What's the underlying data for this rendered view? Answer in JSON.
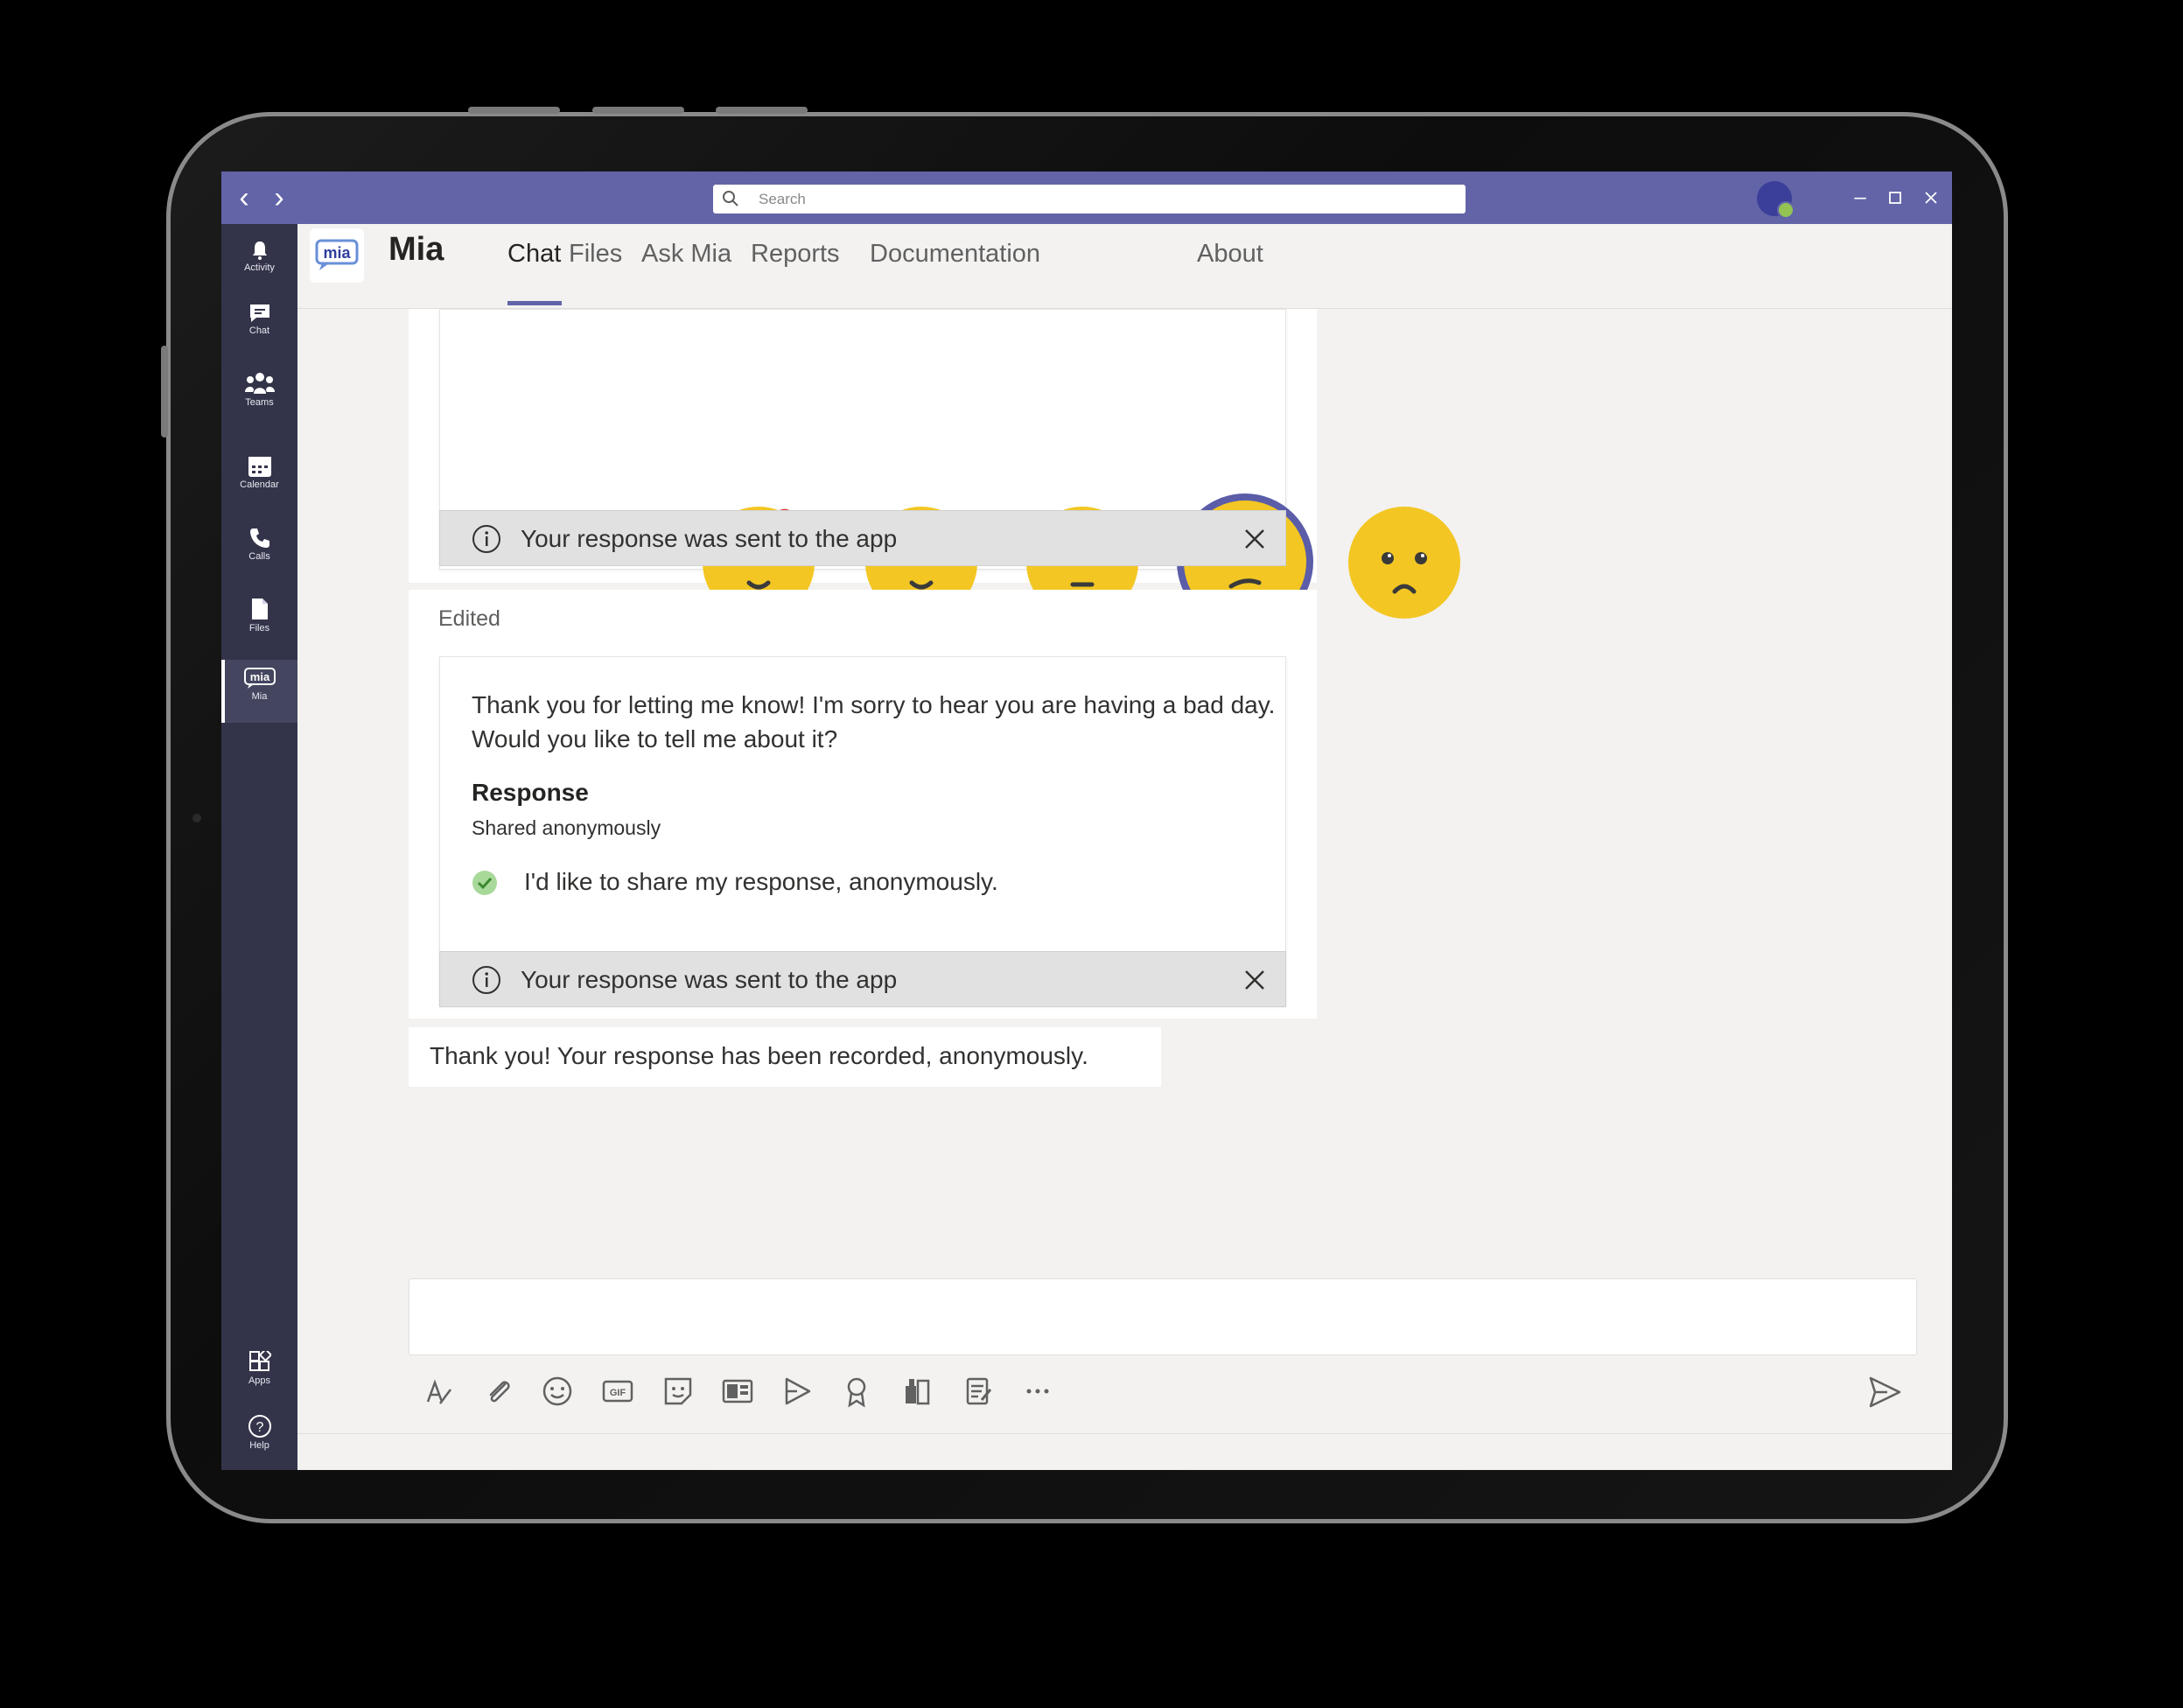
{
  "titlebar": {
    "search_placeholder": "Search",
    "accent": "#6264a7"
  },
  "rail": {
    "items": [
      {
        "label": "Activity",
        "icon": "bell-icon"
      },
      {
        "label": "Chat",
        "icon": "chat-icon"
      },
      {
        "label": "Teams",
        "icon": "teams-icon"
      },
      {
        "label": "Calendar",
        "icon": "calendar-icon"
      },
      {
        "label": "Calls",
        "icon": "phone-icon"
      },
      {
        "label": "Files",
        "icon": "file-icon"
      },
      {
        "label": "Mia",
        "icon": "mia-icon",
        "active": true
      }
    ],
    "bottom": [
      {
        "label": "Apps",
        "icon": "apps-icon"
      },
      {
        "label": "Help",
        "icon": "help-icon"
      }
    ]
  },
  "app": {
    "logo_text": "mia",
    "name": "Mia",
    "tabs": [
      "Chat",
      "Files",
      "Ask Mia",
      "Reports",
      "Documentation",
      "About"
    ],
    "active_tab": "Chat"
  },
  "chat": {
    "mood_card": {
      "emojis": [
        "love-face-icon",
        "happy-face-icon",
        "neutral-face-icon",
        "confused-face-icon",
        "sad-face-icon"
      ],
      "selected_index": 3,
      "notice": "Your response was sent to the app"
    },
    "edited_label": "Edited",
    "response_card": {
      "message": "Thank you for letting me know! I'm sorry to hear you are having a bad day. Would you like to tell me about it?",
      "response_title": "Response",
      "response_subtitle": "Shared anonymously",
      "checked_option": "I'd like to share my response, anonymously.",
      "notice": "Your response was sent to the app"
    },
    "thanks_message": "Thank you! Your response has been recorded, anonymously."
  },
  "compose": {
    "tools": [
      "format-icon",
      "attach-icon",
      "emoji-icon",
      "gif-icon",
      "sticker-icon",
      "meet-now-icon",
      "stream-icon",
      "praise-icon",
      "approvals-icon",
      "forms-icon",
      "more-icon"
    ]
  }
}
